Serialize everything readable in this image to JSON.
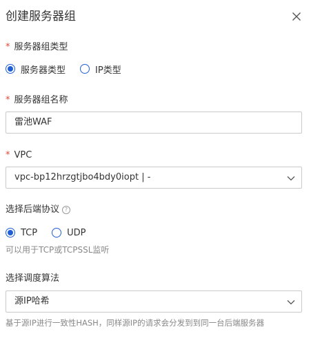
{
  "dialog": {
    "title": "创建服务器组"
  },
  "group_type": {
    "required_mark": "*",
    "label": "服务器组类型",
    "options": [
      "服务器类型",
      "IP类型"
    ],
    "selected": "服务器类型"
  },
  "group_name": {
    "required_mark": "*",
    "label": "服务器组名称",
    "value": "雷池WAF"
  },
  "vpc": {
    "required_mark": "*",
    "label": "VPC",
    "value": "vpc-bp12hrzgtjbo4bdy0iopt | -"
  },
  "protocol": {
    "label": "选择后端协议",
    "help_icon": "?",
    "options": [
      "TCP",
      "UDP"
    ],
    "selected": "TCP",
    "hint": "可以用于TCP或TCPSSL监听"
  },
  "scheduler": {
    "label": "选择调度算法",
    "value": "源IP哈希",
    "hint": "基于源IP进行一致性HASH，同样源IP的请求会分发到到同一台后端服务器"
  },
  "icons": {
    "close": "close-icon",
    "dropdown": "chevron-down-icon",
    "help": "question-circle-icon"
  },
  "colors": {
    "accent": "#1f5ed6",
    "required": "#e84738",
    "border": "#c9c9c9",
    "hint": "#888888"
  }
}
